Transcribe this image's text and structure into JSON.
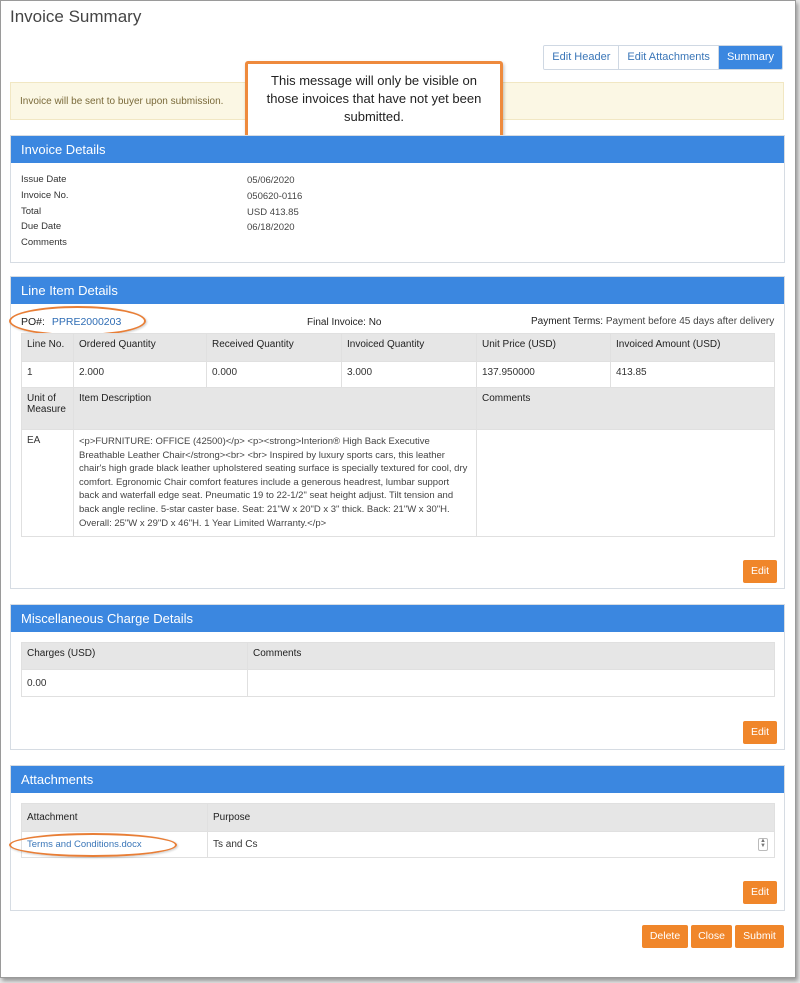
{
  "page": {
    "title": "Invoice Summary"
  },
  "tabs": [
    {
      "label": "Edit Header"
    },
    {
      "label": "Edit Attachments"
    },
    {
      "label": "Summary"
    }
  ],
  "alert": {
    "text": "Invoice will be sent to buyer upon submission."
  },
  "callout": {
    "text": "This message will only be visible on those invoices that have not yet been submitted."
  },
  "invoice_details": {
    "title": "Invoice Details",
    "rows": [
      {
        "label": "Issue Date",
        "value": "05/06/2020"
      },
      {
        "label": "Invoice No.",
        "value": "050620-0116"
      },
      {
        "label": "Total",
        "value": "USD 413.85"
      },
      {
        "label": "Due Date",
        "value": "06/18/2020"
      },
      {
        "label": "Comments",
        "value": ""
      }
    ]
  },
  "line_items": {
    "title": "Line Item Details",
    "po_label": "PO#:",
    "po_number": "PPRE2000203",
    "final_invoice_label": "Final Invoice:",
    "final_invoice_value": "No",
    "payment_terms_label": "Payment Terms:",
    "payment_terms_value": "Payment before 45 days after delivery",
    "headers": [
      "Line No.",
      "Ordered Quantity",
      "Received Quantity",
      "Invoiced Quantity",
      "Unit Price (USD)",
      "Invoiced Amount (USD)"
    ],
    "row": [
      "1",
      "2.000",
      "0.000",
      "3.000",
      "137.950000",
      "413.85"
    ],
    "headers2": [
      "Unit of Measure",
      "Item Description",
      "Comments"
    ],
    "uom": "EA",
    "description": "<p>FURNITURE: OFFICE (42500)</p> <p><strong>Interion® High Back Executive Breathable Leather Chair</strong><br> <br> Inspired by luxury sports cars, this leather chair's high grade black leather upholstered seating surface is specially textured for cool, dry comfort. Egronomic Chair comfort features include a generous headrest, lumbar support back and waterfall edge seat. Pneumatic 19 to 22-1/2\" seat height adjust. Tilt tension and back angle recline. 5-star caster base. Seat: 21\"W x 20\"D x 3\" thick. Back: 21\"W x 30\"H. Overall: 25\"W x 29\"D x 46\"H. 1 Year Limited Warranty.</p>",
    "comments": "",
    "edit_label": "Edit"
  },
  "misc": {
    "title": "Miscellaneous Charge Details",
    "headers": [
      "Charges (USD)",
      "Comments"
    ],
    "row": [
      "0.00",
      ""
    ],
    "edit_label": "Edit"
  },
  "attachments": {
    "title": "Attachments",
    "headers": [
      "Attachment",
      "Purpose"
    ],
    "file": "Terms and Conditions.docx",
    "purpose": "Ts and Cs",
    "edit_label": "Edit"
  },
  "footer": {
    "delete_label": "Delete",
    "close_label": "Close",
    "submit_label": "Submit"
  },
  "colors": {
    "panel_header": "#3b87e0",
    "button": "#f0862a",
    "highlight": "#e87e36"
  }
}
